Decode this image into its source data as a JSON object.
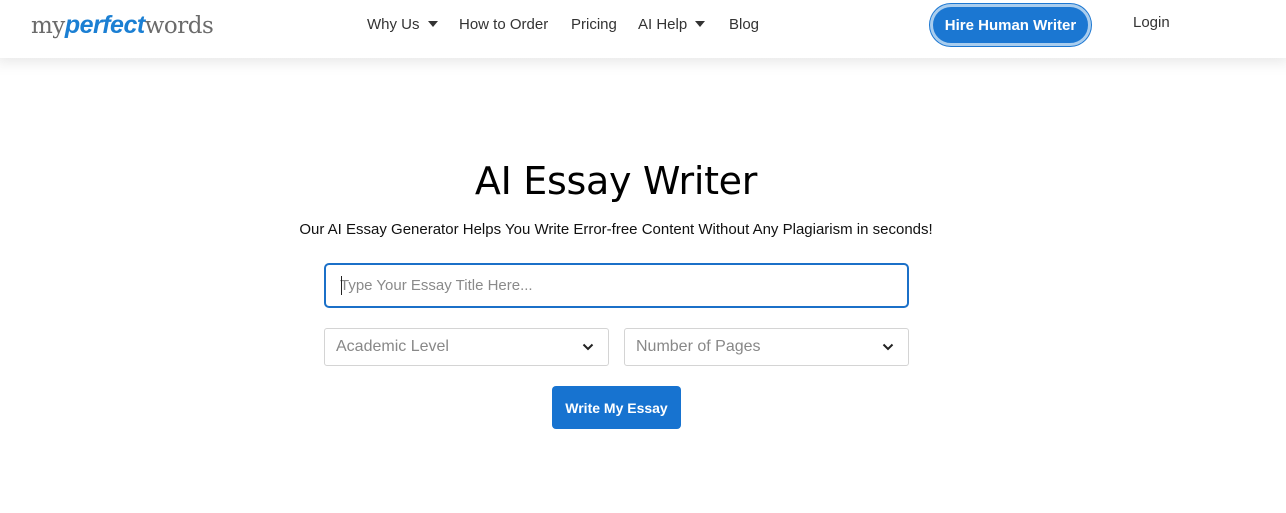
{
  "logo": {
    "part1": "my",
    "part2": "perfect",
    "part3": "words"
  },
  "nav": {
    "items": [
      {
        "label": "Why Us",
        "has_dropdown": true
      },
      {
        "label": "How to Order",
        "has_dropdown": false
      },
      {
        "label": "Pricing",
        "has_dropdown": false
      },
      {
        "label": "AI Help",
        "has_dropdown": true
      },
      {
        "label": "Blog",
        "has_dropdown": false
      }
    ],
    "hire_button": "Hire Human Writer",
    "login": "Login"
  },
  "hero": {
    "title": "AI Essay Writer",
    "subtitle": "Our AI Essay Generator Helps You Write Error-free Content Without Any Plagiarism in seconds!"
  },
  "form": {
    "title_input": {
      "placeholder": "Type Your Essay Title Here...",
      "value": ""
    },
    "academic_level": {
      "selected": "Academic Level"
    },
    "pages": {
      "selected": "Number of Pages"
    },
    "submit_label": "Write My Essay"
  },
  "colors": {
    "brand_blue": "#1b77d2",
    "logo_gray": "#6b6b6b",
    "input_border": "#1b70c8"
  },
  "icons": [
    "dropdown-caret-icon",
    "chevron-down-icon"
  ]
}
